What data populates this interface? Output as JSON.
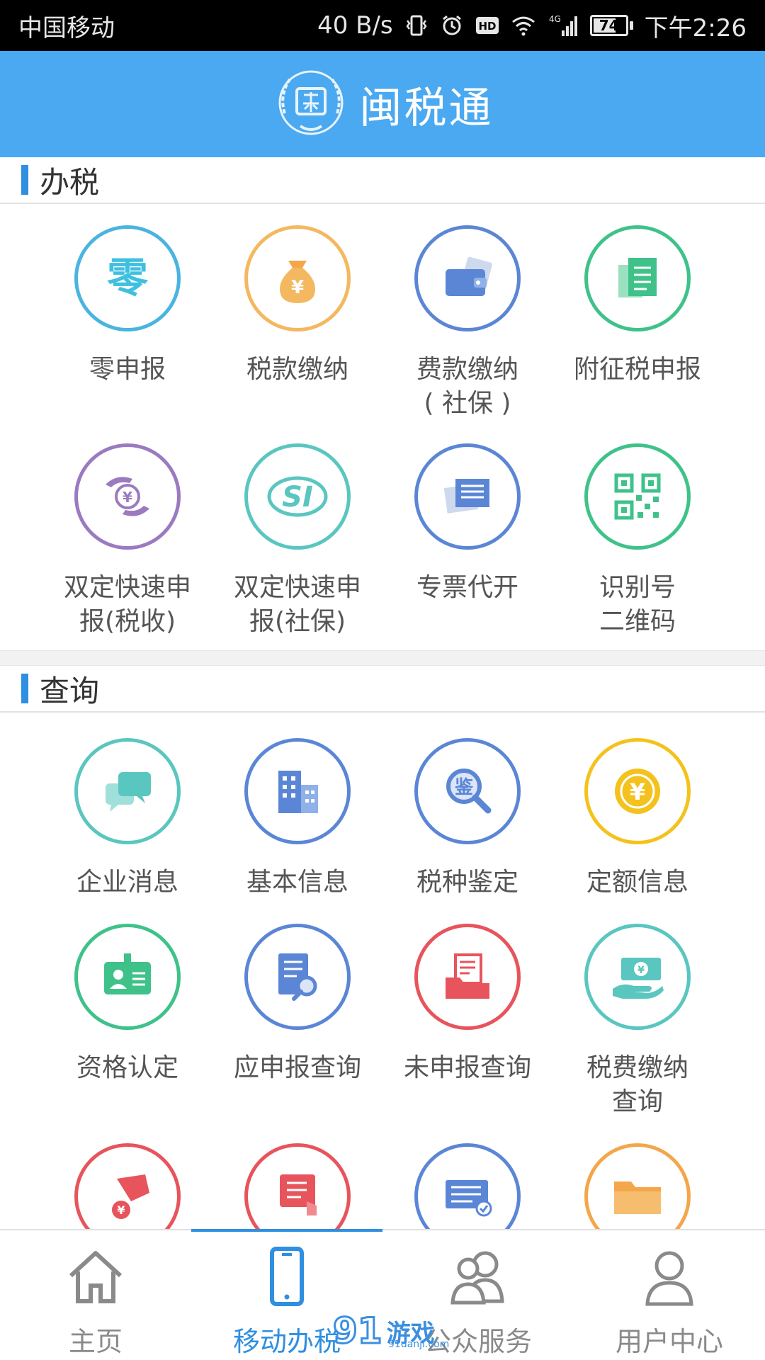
{
  "status_bar": {
    "carrier": "中国移动",
    "speed": "40 B/s",
    "hd": "HD",
    "network": "4G",
    "battery": "74",
    "battery_level": 0.74,
    "time": "下午2:26"
  },
  "header": {
    "title": "闽税通",
    "logo_icon": "tax-emblem-icon"
  },
  "sections": [
    {
      "title": "办税",
      "items": [
        {
          "label": "零申报",
          "icon": "zero-declare-icon",
          "color": "#4ab4e0"
        },
        {
          "label": "税款缴纳",
          "icon": "money-bag-icon",
          "color": "#f4b860"
        },
        {
          "label": "费款缴纳\n( 社保 )",
          "icon": "wallet-icon",
          "color": "#5b86d6"
        },
        {
          "label": "附征税申报",
          "icon": "document-stack-icon",
          "color": "#3fc28a"
        },
        {
          "label": "双定快速申\n报(税收)",
          "icon": "hands-coin-icon",
          "color": "#9b7ac0"
        },
        {
          "label": "双定快速申\n报(社保)",
          "icon": "si-icon",
          "color": "#5ac6c0"
        },
        {
          "label": "专票代开",
          "icon": "invoice-icon",
          "color": "#5b86d6"
        },
        {
          "label": "识别号\n二维码",
          "icon": "qr-code-icon",
          "color": "#3fc28a"
        }
      ]
    },
    {
      "title": "查询",
      "items": [
        {
          "label": "企业消息",
          "icon": "chat-bubbles-icon",
          "color": "#5ac6c0"
        },
        {
          "label": "基本信息",
          "icon": "building-icon",
          "color": "#5b86d6"
        },
        {
          "label": "税种鉴定",
          "icon": "magnifier-icon",
          "color": "#5b86d6"
        },
        {
          "label": "定额信息",
          "icon": "yen-coin-icon",
          "color": "#f4c21c"
        },
        {
          "label": "资格认定",
          "icon": "id-badge-icon",
          "color": "#3fc28a"
        },
        {
          "label": "应申报查询",
          "icon": "doc-search-icon",
          "color": "#5b86d6"
        },
        {
          "label": "未申报查询",
          "icon": "tray-doc-icon",
          "color": "#e8545c"
        },
        {
          "label": "税费缴纳\n查询",
          "icon": "cash-hand-icon",
          "color": "#5ac6c0"
        },
        {
          "label": "",
          "icon": "hand-coin-icon",
          "color": "#e8545c"
        },
        {
          "label": "",
          "icon": "tablet-touch-icon",
          "color": "#e8545c"
        },
        {
          "label": "",
          "icon": "list-check-icon",
          "color": "#5b86d6"
        },
        {
          "label": "",
          "icon": "folder-icon",
          "color": "#f4a64a"
        }
      ]
    }
  ],
  "bottom_nav": [
    {
      "label": "主页",
      "icon": "home-icon"
    },
    {
      "label": "移动办税",
      "icon": "phone-icon",
      "active": true
    },
    {
      "label": "公众服务",
      "icon": "users-icon"
    },
    {
      "label": "用户中心",
      "icon": "user-icon"
    }
  ],
  "watermark": {
    "num": "91",
    "text": "游戏",
    "url": "91danji.com"
  },
  "colors": {
    "header_bg": "#4aa9f0",
    "accent": "#2f8fe0"
  }
}
